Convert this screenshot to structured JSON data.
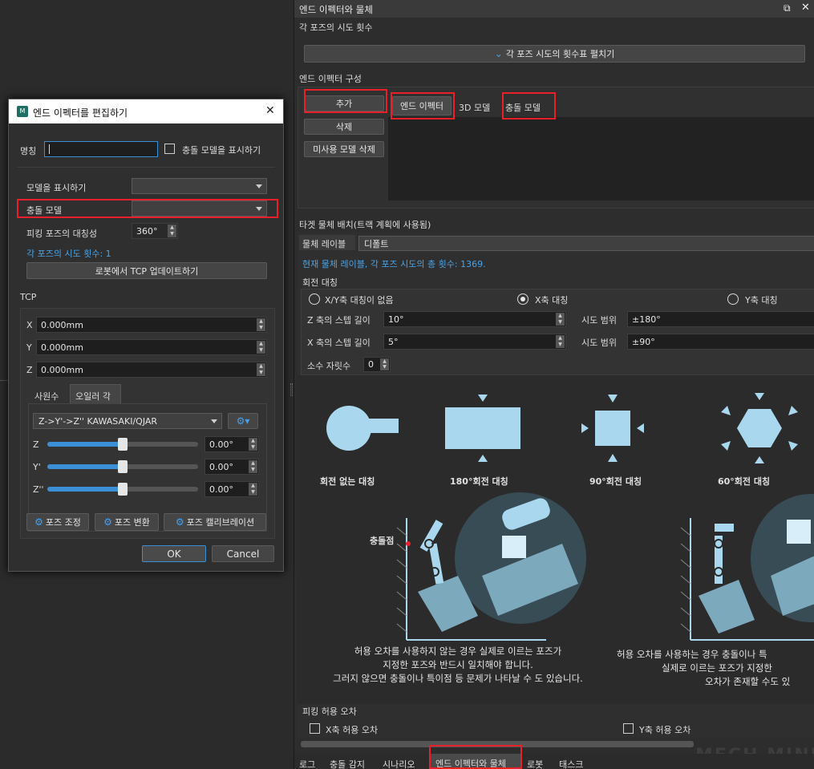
{
  "dialog": {
    "title": "엔드 이펙터를 편집하기",
    "close_glyph": "✕",
    "name_label": "명칭",
    "name_value": "",
    "show_collision_label": "충돌 모델을 표시하기",
    "display_model_label": "모델을 표시하기",
    "display_model_value": "",
    "collision_model_label": "충돌 모델",
    "collision_model_value": "",
    "symmetry_label": "피킹 포즈의 대칭성",
    "symmetry_value": "360°",
    "attempts_text": "각 포즈의 시도 횟수: 1",
    "update_tcp_button": "로봇에서 TCP 업데이트하기",
    "tcp_label": "TCP",
    "tcp_fields": [
      {
        "axis": "X",
        "value": "0.000mm"
      },
      {
        "axis": "Y",
        "value": "0.000mm"
      },
      {
        "axis": "Z",
        "value": "0.000mm"
      }
    ],
    "tabs": [
      "사원수",
      "오일러 각"
    ],
    "active_tab": "오일러 각",
    "euler_convention": "Z->Y'->Z'' KAWASAKI/QJAR",
    "euler_rows": [
      {
        "axis": "Z",
        "value": "0.00°",
        "level": 0.5
      },
      {
        "axis": "Y'",
        "value": "0.00°",
        "level": 0.5
      },
      {
        "axis": "Z''",
        "value": "0.00°",
        "level": 0.5
      }
    ],
    "pose_buttons": [
      "포즈 조정",
      "포즈 변환",
      "포즈 캘리브레이션"
    ],
    "ok_button": "OK",
    "cancel_button": "Cancel"
  },
  "panel": {
    "title": "엔드 이펙터와 물체",
    "restore_glyph": "⧉",
    "close_glyph": "✕",
    "attempts_section_title": "각 포즈의 시도 횟수",
    "expand_button": "각 포즈 시도의 횟수표 펼치기",
    "ee_config_title": "엔드 이펙터 구성",
    "add_button": "추가",
    "delete_button": "삭제",
    "delete_unused_button": "미사용 모델 삭제",
    "model_tabs": [
      "엔드 이펙터",
      "3D 모델",
      "충돌 모델"
    ],
    "target_section_title": "타겟 물체 배치(트랙 계획에 사용됨)",
    "object_label_title": "물체 레이블",
    "object_label_value": "디폴트",
    "current_info": "현재 물체 레이블, 각 포즈 시도의 총 횟수: 1369.",
    "rotation_symmetry_title": "회전 대칭",
    "radio_options": [
      {
        "label": "X/Y축 대칭이 없음",
        "selected": false
      },
      {
        "label": "X축 대칭",
        "selected": true
      },
      {
        "label": "Y축 대칭",
        "selected": false
      }
    ],
    "z_step_label": "Z 축의 스텝 길이",
    "z_step_value": "10°",
    "z_range_label": "시도 범위",
    "z_range_value": "±180°",
    "x_step_label": "X 축의 스텝 길이",
    "x_step_value": "5°",
    "x_range_label": "시도 범위",
    "x_range_value": "±90°",
    "decimal_label": "소수 자릿수",
    "decimal_value": "0",
    "symmetry_captions": [
      "회전 없는 대칭",
      "180°회전 대칭",
      "90°회전 대칭",
      "60°회전 대칭"
    ],
    "collision_point_label": "충돌점",
    "desc_left": [
      "허용 오차를 사용하지 않는 경우 실제로 이르는 포즈가",
      "지정한 포즈와 반드시 일치해야 합니다.",
      "그러지 않으면 충돌이나 특이점 등 문제가 나타날 수 도 있습니다."
    ],
    "desc_right": [
      "허용 오차를 사용하는 경우 충돌이나 특",
      "실제로 이르는 포즈가 지정한",
      "오차가 존재할 수도 있"
    ],
    "tolerance_title": "피킹 허용 오차",
    "x_tolerance_label": "X축 허용 오차",
    "y_tolerance_label": "Y축 허용 오차"
  },
  "bottom_tabs": [
    "로그",
    "충돌 감지",
    "시나리오",
    "엔드 이펙터와 물체",
    "로봇",
    "태스크"
  ],
  "active_bottom_tab": "엔드 이펙터와 물체",
  "watermark": "MECH MIND",
  "colors": {
    "accent": "#3a8fd6",
    "highlight": "#e8202a",
    "info_text": "#4aa3e6"
  }
}
